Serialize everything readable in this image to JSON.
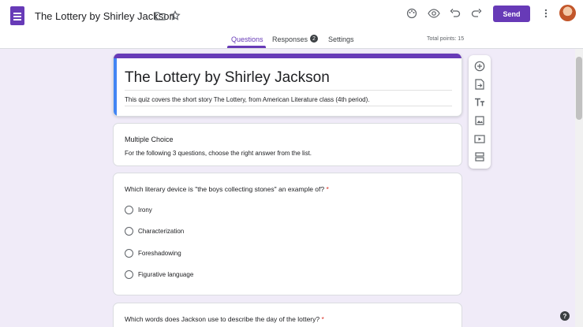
{
  "header": {
    "doc_title": "The Lottery by Shirley Jackson",
    "send_label": "Send",
    "icons": [
      "folder-icon",
      "star-icon",
      "palette-icon",
      "eye-icon",
      "undo-icon",
      "redo-icon",
      "more-vert-icon"
    ]
  },
  "tabs": {
    "questions": "Questions",
    "responses": "Responses",
    "responses_count": "2",
    "settings": "Settings",
    "active": "questions"
  },
  "total_points": "Total points: 15",
  "form": {
    "title": "The Lottery by Shirley Jackson",
    "description": "This quiz covers the short story The Lottery, from American Literature class (4th period)."
  },
  "section": {
    "title": "Multiple Choice",
    "description": "For the following 3 questions, choose the right answer from the list."
  },
  "questions": [
    {
      "text": "Which literary device is \"the boys collecting stones\" an example of?",
      "required_mark": "*",
      "options": [
        "Irony",
        "Characterization",
        "Foreshadowing",
        "Figurative language"
      ]
    },
    {
      "text": "Which words does Jackson use to describe the day of the lottery?",
      "required_mark": "*"
    }
  ],
  "toolbar": {
    "items": [
      "add-question",
      "import-questions",
      "add-title-description",
      "add-image",
      "add-video",
      "add-section"
    ]
  },
  "help_label": "?",
  "colors": {
    "accent": "#673ab7",
    "background": "#f0ebf8",
    "focus": "#4285f4",
    "required": "#d93025"
  }
}
